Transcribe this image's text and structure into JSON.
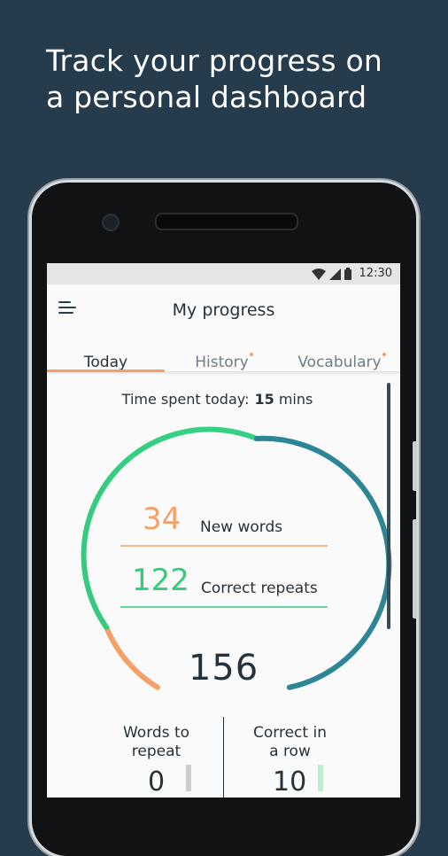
{
  "promo": {
    "line1": "Track your progress on",
    "line2": "a personal dashboard"
  },
  "statusbar": {
    "time": "12:30"
  },
  "appbar": {
    "title": "My progress"
  },
  "tabs": [
    {
      "label": "Today",
      "active": true
    },
    {
      "label": "History",
      "has_dot": true
    },
    {
      "label": "Vocabulary",
      "has_dot": true
    }
  ],
  "time_spent": {
    "label": "Time spent today:",
    "value": "15",
    "unit": "mins"
  },
  "stats": {
    "new_words": {
      "value": "34",
      "label": "New words"
    },
    "correct_repeats": {
      "value": "122",
      "label": "Correct repeats"
    },
    "total": "156"
  },
  "bottom": {
    "words_to_repeat": {
      "line1": "Words to",
      "line2": "repeat",
      "value": "0"
    },
    "correct_in_a_row": {
      "line1": "Correct in",
      "line2": "a row",
      "value": "10"
    }
  },
  "colors": {
    "orange": "#f4a066",
    "green": "#33cc7a",
    "teal": "#2d8596",
    "background": "#263c4c"
  }
}
